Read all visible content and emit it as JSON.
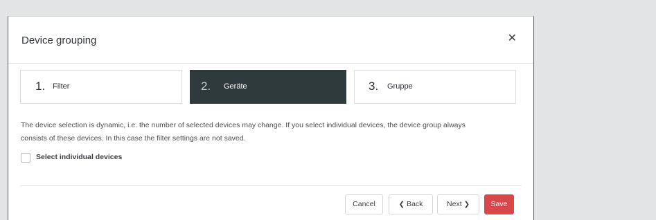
{
  "dialog": {
    "title": "Device grouping",
    "close_icon": "close-icon"
  },
  "steps": [
    {
      "number": "1.",
      "label": "Filter",
      "active": false
    },
    {
      "number": "2.",
      "label": "Geräte",
      "active": true
    },
    {
      "number": "3.",
      "label": "Gruppe",
      "active": false
    }
  ],
  "info": {
    "line1": "The device selection is dynamic, i.e. the number of selected devices may change. If you select individual devices, the device group always",
    "line2": "consists of these devices. In this case the filter settings are not saved."
  },
  "checkbox": {
    "label": "Select individual devices",
    "checked": false
  },
  "footer": {
    "cancel_label": "Cancel",
    "back_label": "Back",
    "back_icon": "chevron-left-icon",
    "next_label": "Next",
    "next_icon": "chevron-right-icon",
    "save_label": "Save"
  },
  "colors": {
    "active_step_bg": "#2f3a3d",
    "save_button_bg": "#d9474a",
    "page_bg": "#e3e4e5"
  }
}
